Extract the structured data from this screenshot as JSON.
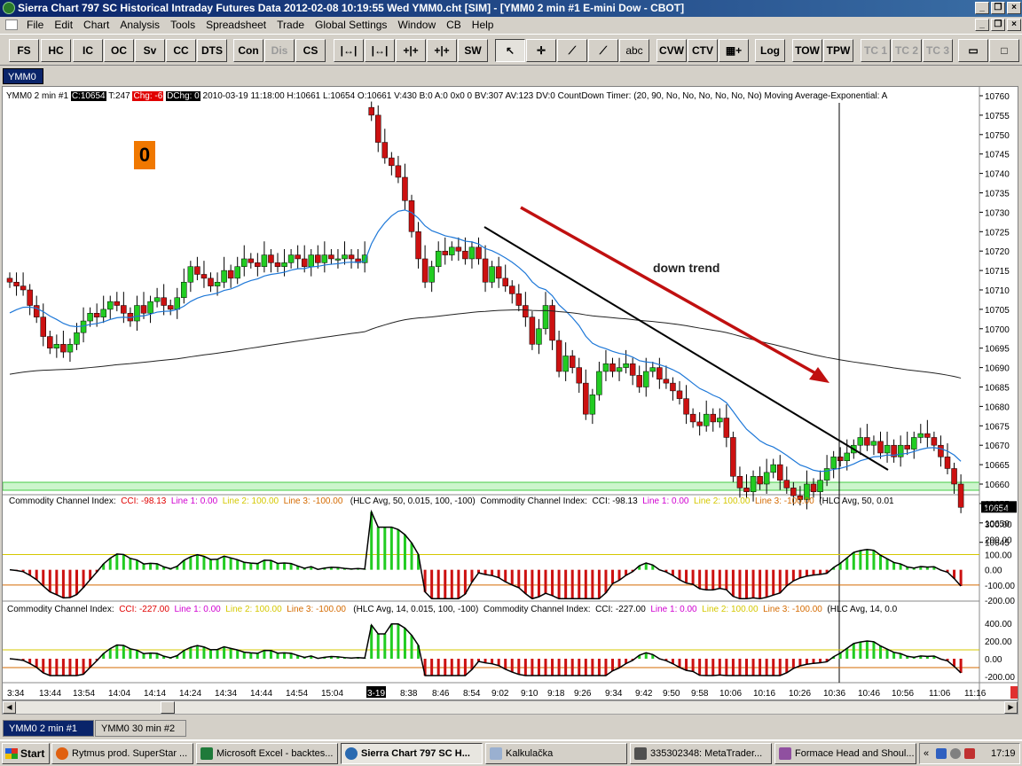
{
  "window": {
    "title": "Sierra Chart 797 SC Historical Intraday Futures Data 2012-02-08  10:19:55 Wed  YMM0.cht [SIM] - [YMM0  2 min  #1  E-mini Dow - CBOT]"
  },
  "menu": [
    "File",
    "Edit",
    "Chart",
    "Analysis",
    "Tools",
    "Spreadsheet",
    "Trade",
    "Global Settings",
    "Window",
    "CB",
    "Help"
  ],
  "toolbar": {
    "buttons": [
      "FS",
      "HC",
      "IC",
      "OC",
      "Sv",
      "CC",
      "DTS",
      "Con",
      "Dis",
      "CS",
      "SW",
      "CVW",
      "CTV",
      "Log",
      "TOW",
      "TPW",
      "TC 1",
      "TC 2",
      "TC 3"
    ],
    "draw_tool_text": "abc"
  },
  "chart_tab": "YMM0",
  "info": {
    "symbol": "YMM0  2 min   #1",
    "c": "C:10654",
    "t": "T:247",
    "chg": "Chg: -6",
    "dchg": "DChg: 0",
    "rest": "2010-03-19 11:18:00 H:10661 L:10654 O:10661 V:430 B:0 A:0 0x0 0 BV:307 AV:123 DV:0 CountDown Timer:  (20, 90, No, No, No, No, No, No)  Moving Average-Exponential:  A"
  },
  "big_counter": "0",
  "annotation": "down trend",
  "price_axis": [
    "10760",
    "10755",
    "10750",
    "10745",
    "10740",
    "10735",
    "10730",
    "10725",
    "10720",
    "10715",
    "10710",
    "10705",
    "10700",
    "10695",
    "10690",
    "10685",
    "10680",
    "10675",
    "10670",
    "10665",
    "10660",
    "10655",
    "10650",
    "10645"
  ],
  "last_price": "10654",
  "cci1": {
    "name": "Commodity Channel Index:",
    "cci": "CCI: -98.13",
    "l1": "Line 1: 0.00",
    "l2": "Line 2: 100.00",
    "l3": "Line 3: -100.00",
    "params": "(HLC Avg, 50, 0.015, 100, -100)",
    "params2": "(HLC Avg, 50, 0.01",
    "axis": [
      "400.00",
      "300.00",
      "200.00",
      "100.00",
      "0.00",
      "-100.00",
      "-200.00"
    ]
  },
  "cci2": {
    "name": "Commodity Channel Index:",
    "cci": "CCI: -227.00",
    "l1": "Line 1: 0.00",
    "l2": "Line 2: 100.00",
    "l3": "Line 3: -100.00",
    "params": "(HLC Avg, 14, 0.015, 100, -100)",
    "params2": "(HLC Avg, 14, 0.0",
    "axis": [
      "400.00",
      "200.00",
      "0.00",
      "-200.00"
    ]
  },
  "time_axis": [
    "3:34",
    "13:44",
    "13:54",
    "14:04",
    "14:14",
    "14:24",
    "14:34",
    "14:44",
    "14:54",
    "15:04",
    "3-19",
    "8:38",
    "8:46",
    "8:54",
    "9:02",
    "9:10",
    "9:18",
    "9:26",
    "9:34",
    "9:42",
    "9:50",
    "9:58",
    "10:06",
    "10:16",
    "10:26",
    "10:36",
    "10:46",
    "10:56",
    "11:06",
    "11:16"
  ],
  "sheets": [
    "YMM0  2 min   #1",
    "YMM0  30 min   #2"
  ],
  "taskbar": {
    "start": "Start",
    "items": [
      "Rytmus prod. SuperStar ...",
      "Microsoft Excel - backtes...",
      "Sierra Chart 797 SC H...",
      "Kalkulačka",
      "335302348: MetaTrader...",
      "Formace Head and Shoul..."
    ],
    "clock": "17:19"
  },
  "colors": {
    "up": "#22cc22",
    "down": "#cc1111",
    "ema": "#1e78d8",
    "trend_arrow": "#c01010"
  }
}
